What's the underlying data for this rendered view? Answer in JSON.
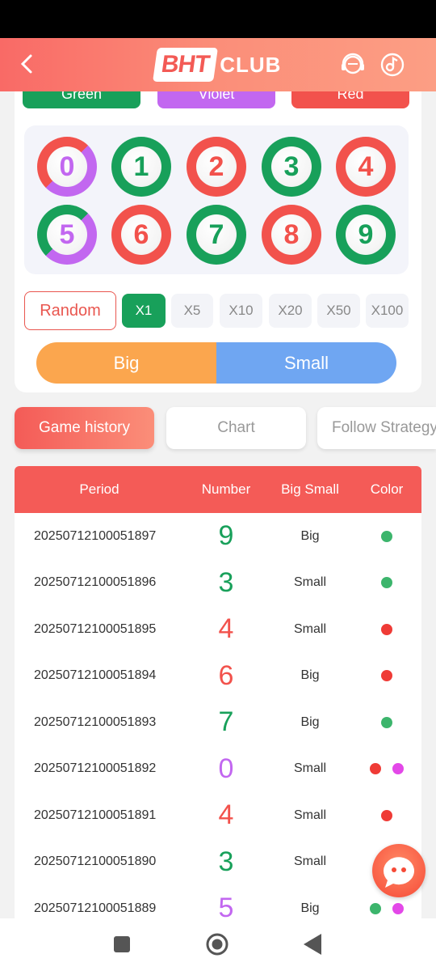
{
  "header": {
    "logo_box": "BHT",
    "logo_text": "CLUB"
  },
  "color_buttons": [
    {
      "label": "Green",
      "color": "#18a05a"
    },
    {
      "label": "Violet",
      "color": "#c267f0"
    },
    {
      "label": "Red",
      "color": "#f2524c"
    }
  ],
  "balls": [
    "0",
    "1",
    "2",
    "3",
    "4",
    "5",
    "6",
    "7",
    "8",
    "9"
  ],
  "random_label": "Random",
  "multipliers": [
    "X1",
    "X5",
    "X10",
    "X20",
    "X50",
    "X100"
  ],
  "big_label": "Big",
  "small_label": "Small",
  "tabs": [
    "Game history",
    "Chart",
    "Follow Strategy"
  ],
  "table": {
    "headers": [
      "Period",
      "Number",
      "Big Small",
      "Color"
    ],
    "rows": [
      {
        "period": "20250712100051897",
        "number": "9",
        "size": "Big"
      },
      {
        "period": "20250712100051896",
        "number": "3",
        "size": "Small"
      },
      {
        "period": "20250712100051895",
        "number": "4",
        "size": "Small"
      },
      {
        "period": "20250712100051894",
        "number": "6",
        "size": "Big"
      },
      {
        "period": "20250712100051893",
        "number": "7",
        "size": "Big"
      },
      {
        "period": "20250712100051892",
        "number": "0",
        "size": "Small"
      },
      {
        "period": "20250712100051891",
        "number": "4",
        "size": "Small"
      },
      {
        "period": "20250712100051890",
        "number": "3",
        "size": "Small"
      },
      {
        "period": "20250712100051889",
        "number": "5",
        "size": "Big"
      }
    ]
  },
  "colors": {
    "green": "#18a05a",
    "red": "#f2524c",
    "violet": "#c267f0",
    "big": "#fba64e",
    "small": "#6fa6f2"
  }
}
